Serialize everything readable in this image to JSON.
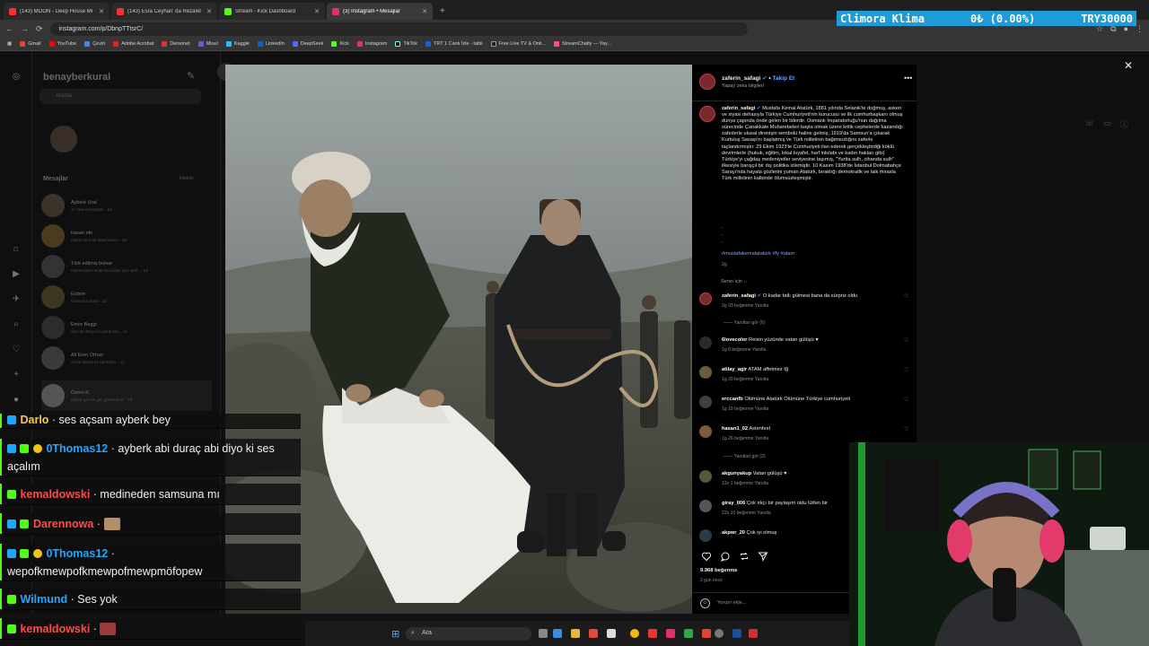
{
  "browser": {
    "tabs": [
      {
        "title": "(143) MOON - Deep House Mi",
        "color": "#ff2d2d",
        "active": false
      },
      {
        "title": "(143) Esra Ceyhan' da Rezalet",
        "color": "#ff2d2d",
        "active": false
      },
      {
        "title": "Stream - Kick Dashboard",
        "color": "#53fc18",
        "active": false
      },
      {
        "title": "(3) Instagram • Mesajlar",
        "color": "#e1306c",
        "active": true
      }
    ],
    "url": "instagram.com/p/DbnpTTtsrC/",
    "bookmarks": [
      "Gmail",
      "YouTube",
      "Çeviri",
      "Adobe Acrobat",
      "Dersonet",
      "Miuul",
      "Kaggle",
      "LinkedIn",
      "DeepSeek",
      "Kick",
      "Instagram",
      "TikTok",
      "TRT 1 Canlı İzle - tabii",
      "Free Live TV & Onli...",
      "StreamChatly — Yay..."
    ]
  },
  "ticker": {
    "name": "Climora Klima",
    "change": "0₺ (0.00%)",
    "goal": "TRY30000"
  },
  "instagram": {
    "username": "benayberkural",
    "search_placeholder": "Arama",
    "messages_label": "Mesajlar",
    "requests_label": "İstekler",
    "conversations": [
      {
        "name": "Ayberk Ural",
        "sub": "4+ new messages · 1d"
      },
      {
        "name": "hasan efe",
        "sub": "hasan sent an attachment. · 4d"
      },
      {
        "name": "Türk edilmiş bulvar",
        "sub": "Müneccime neden bu kadar şeyi aktif ... 1d"
      },
      {
        "name": "Erdem",
        "sub": "Konuşma açıldı · 2d"
      },
      {
        "name": "Emre Beggi",
        "sub": "Sen de dünya mı görürsün... 1s"
      },
      {
        "name": "Ali Eren Orhan",
        "sub": "Ali bir dünya mı görürsün... 1s"
      },
      {
        "name": "Özem K.",
        "sub": "Dikkat göz ve göz görürsünüz · 2d"
      }
    ]
  },
  "post": {
    "author": "zaferin_safagi",
    "follow": "Takip Et",
    "subtitle": "Yapay zeka bilgileri",
    "watermark": "zaferin_safagi",
    "caption": "Mustafa Kemal Atatürk, 1881 yılında Selanik'te doğmuş, askeri ve siyasi dehasıyla Türkiye Cumhuriyeti'nin kurucusu ve ilk cumhurbaşkanı olmuş dünya çapında önde gelen bir liderdir. Osmanlı İmparatorluğu'nun dağılma sürecinde Çanakkale Muharebeleri başta olmak üzere kritik cephelerde kazandığı zaferlerle ulusal direnişin sembolü haline gelmiş, 1919'da Samsun'a çıkarak Kurtuluş Savaşı'nı başlatmış ve Türk milletinin bağımsızlığını zaferle taçlandırmıştır. 29 Ekim 1923'te Cumhuriyeti ilan ederek gerçekleştirdiği köklü devrimlerle (hukuk, eğitim, lokal kıyafet, harf inkılabı ve kadın hakları gibi) Türkiye'yi çağdaş medeniyetler seviyesine taşımış, \"Yurtta sulh, cihanda sulh\" ilkesiyle barışçıl bir dış politika izlemiştir. 10 Kasım 1938'de İstanbul Dolmabahçe Sarayı'nda hayata gözlerini yuman Atatürk, bıraktığı demokratik ve laik mirasla Türk milletinin kalbinde ölümsüzleşmiştir.",
    "hashtags": "#mustafakemalatatürk #fy #atam",
    "age": "2g",
    "for_you": "Senin için ⌵",
    "likes": "9.968 beğenme",
    "posted_ago": "2 gün önce",
    "comment_placeholder": "Yorum ekle...",
    "comments": [
      {
        "user": "zaferin_safagi",
        "text": "O kadar tatlı gülmesi bana da sürpriz oldu",
        "meta": "2g   93 beğenme   Yanıtla",
        "replies": "Yanıtları gör (6)"
      },
      {
        "user": "6lovecolor",
        "text": "Reisin yüzünde vatan gülüşü ♥",
        "meta": "1g   8 beğenme   Yanıtla",
        "replies": ""
      },
      {
        "user": "atilay_agir",
        "text": "ATAM affetmez İğ",
        "meta": "1g   20 beğenme   Yanıtla",
        "replies": ""
      },
      {
        "user": "erccanfb",
        "text": "Ölümüne Atatürk Ölümüne Türkiye cumhuriyeti",
        "meta": "1g   19 beğenme   Yanıtla",
        "replies": ""
      },
      {
        "user": "hasan1_02",
        "text": "Astımfest",
        "meta": "1g   26 beğenme   Yanıtla",
        "replies": "Yanıtları gör (2)"
      },
      {
        "user": "akgunyakup",
        "text": "Vatan gülüşü ♥",
        "meta": "12s   1 beğenme   Yanıtla",
        "replies": ""
      },
      {
        "user": "giray_006",
        "text": "Çok irkçı bir paylaşım oldu lütfen bir",
        "meta": "22s   10 beğenme   Yanıtla",
        "replies": ""
      },
      {
        "user": "akpwr_20",
        "text": "Çok iyi olmuş",
        "meta": "",
        "replies": ""
      }
    ]
  },
  "chat": [
    {
      "user": "Darlo",
      "text": "· ses açsam ayberk bey",
      "color": "#f7c948"
    },
    {
      "user": "0Thomas12",
      "text": "· ayberk abi duraç abi diyo ki ses açalım",
      "color": "#1ea7ff"
    },
    {
      "user": "kemaldowski",
      "text": "· medineden samsuna mı",
      "color": "#ff4a4a"
    },
    {
      "user": "Darennowa",
      "text": "·",
      "color": "#ff4a4a"
    },
    {
      "user": "0Thomas12",
      "text": "· wepofkmewpofkmewpofmewpmöfopew",
      "color": "#1ea7ff"
    },
    {
      "user": "Wilmund",
      "text": "· Ses yok",
      "color": "#f7c948"
    },
    {
      "user": "kemaldowski",
      "text": "·",
      "color": "#ff4a4a"
    }
  ],
  "taskbar": {
    "search": "Ara"
  }
}
